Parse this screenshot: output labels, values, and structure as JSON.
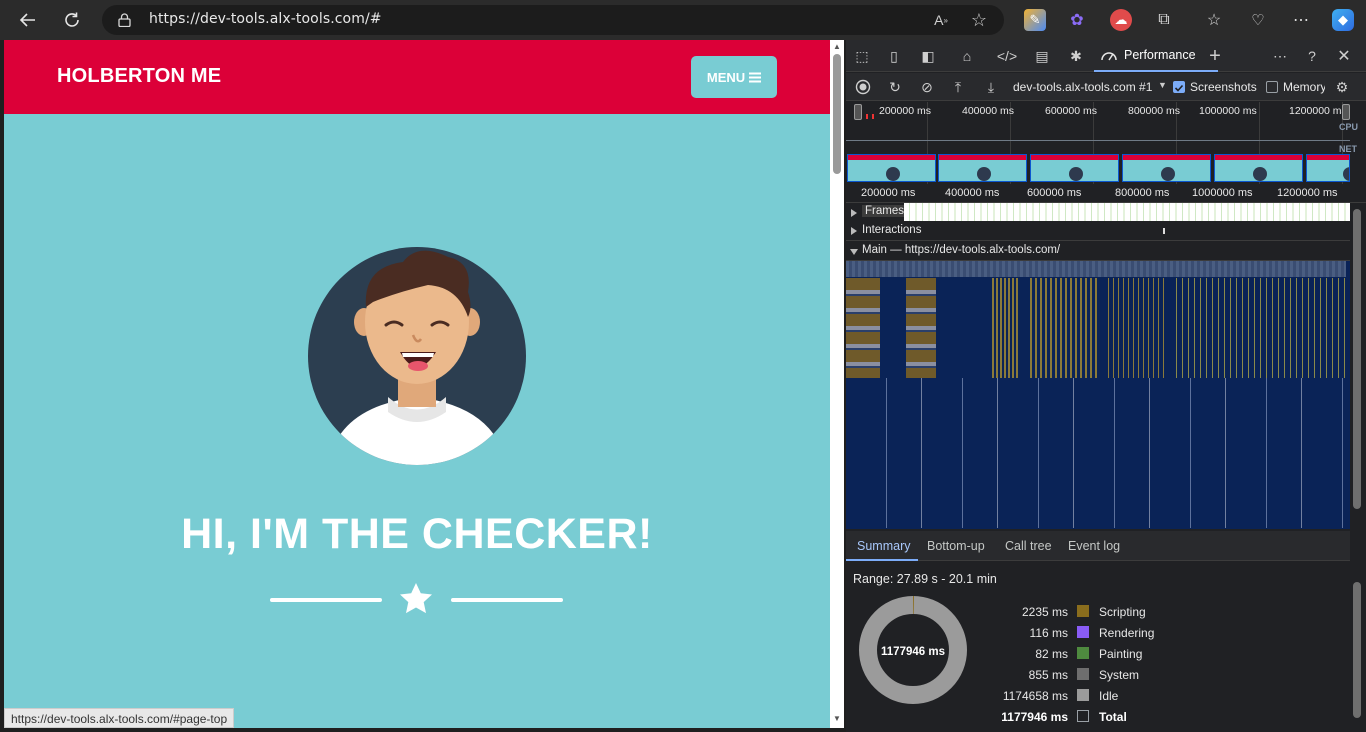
{
  "browser": {
    "url": "https://dev-tools.alx-tools.com/#",
    "status_url": "https://dev-tools.alx-tools.com/#page-top"
  },
  "page": {
    "brand": "HOLBERTON ME",
    "menu_label": "MENU",
    "hero_title": "HI, I'M THE CHECKER!",
    "colors": {
      "header": "#dc0038",
      "background": "#79ccd3",
      "text": "#ffffff"
    }
  },
  "devtools": {
    "active_tab": "Performance",
    "target": "dev-tools.alx-tools.com #1",
    "screenshots_label": "Screenshots",
    "screenshots_checked": true,
    "memory_label": "Memory",
    "memory_checked": false,
    "overview_ticks": [
      "200000 ms",
      "400000 ms",
      "600000 ms",
      "800000 ms",
      "1000000 ms",
      "1200000 ms"
    ],
    "overview_labels": {
      "cpu": "CPU",
      "net": "NET"
    },
    "ruler_ticks": [
      "200000 ms",
      "400000 ms",
      "600000 ms",
      "800000 ms",
      "1000000 ms",
      "1200000 ms"
    ],
    "tracks": {
      "frames": "Frames",
      "interactions": "Interactions",
      "main": "Main — https://dev-tools.alx-tools.com/"
    },
    "sub_tabs": [
      "Summary",
      "Bottom-up",
      "Call tree",
      "Event log"
    ],
    "summary": {
      "range": "Range: 27.89 s - 20.1 min",
      "total_label": "1177946 ms",
      "items": [
        {
          "value": "2235 ms",
          "name": "Scripting",
          "color": "#8a6d1d",
          "ms": 2235
        },
        {
          "value": "116 ms",
          "name": "Rendering",
          "color": "#8a5cf6",
          "ms": 116
        },
        {
          "value": "82 ms",
          "name": "Painting",
          "color": "#4e8a3f",
          "ms": 82
        },
        {
          "value": "855 ms",
          "name": "System",
          "color": "#6e6e6e",
          "ms": 855
        },
        {
          "value": "1174658 ms",
          "name": "Idle",
          "color": "#9b9b9b",
          "ms": 1174658
        },
        {
          "value": "1177946 ms",
          "name": "Total",
          "color": "#202124",
          "ms": 1177946
        }
      ]
    }
  }
}
